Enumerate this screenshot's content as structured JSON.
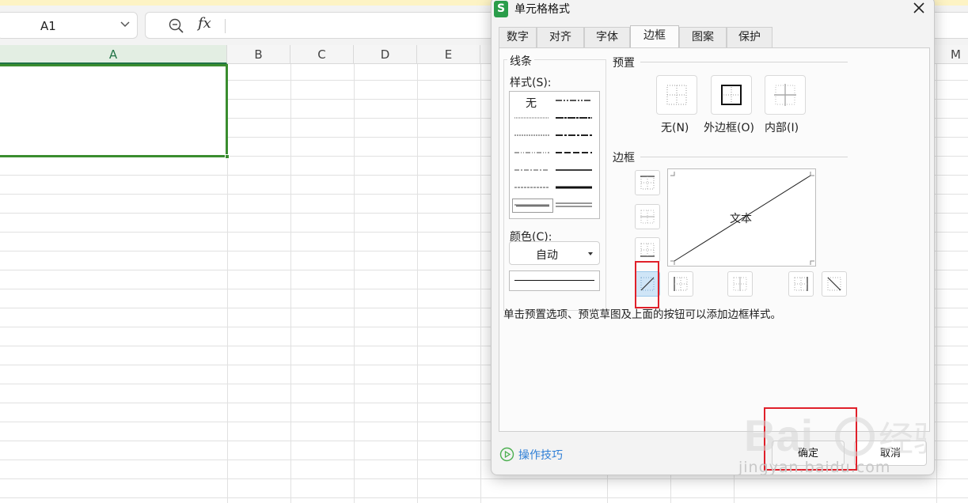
{
  "formula_bar": {
    "cell_ref": "A1",
    "fx_label": "fx"
  },
  "sheet": {
    "columns": [
      "A",
      "B",
      "C",
      "D",
      "E",
      "M"
    ],
    "selected_column": "A",
    "selected_cell": "A1"
  },
  "dialog": {
    "title": "单元格格式",
    "logo_letter": "S",
    "tabs": [
      "数字",
      "对齐",
      "字体",
      "边框",
      "图案",
      "保护"
    ],
    "active_tab": "边框",
    "line_group": {
      "title": "线条",
      "style_label": "样式(S):",
      "style_none": "无",
      "color_label": "颜色(C):",
      "color_value": "自动"
    },
    "preset_group": {
      "title": "预置",
      "buttons": [
        "无(N)",
        "外边框(O)",
        "内部(I)"
      ]
    },
    "border_group": {
      "title": "边框",
      "preview_text": "文本",
      "active_button": "diagonal-up-border"
    },
    "hint": "单击预置选项、预览草图及上面的按钮可以添加边框样式。",
    "tips_link": "操作技巧",
    "ok_label": "确定",
    "cancel_label": "取消"
  },
  "watermark": {
    "text": "jingyan.baidu.com"
  },
  "colors": {
    "accent_green": "#217346",
    "selection_green": "#3a8d2f",
    "highlight_red": "#e0202a",
    "active_button_blue": "#cfe5f7",
    "link_blue": "#2f7fd6"
  }
}
